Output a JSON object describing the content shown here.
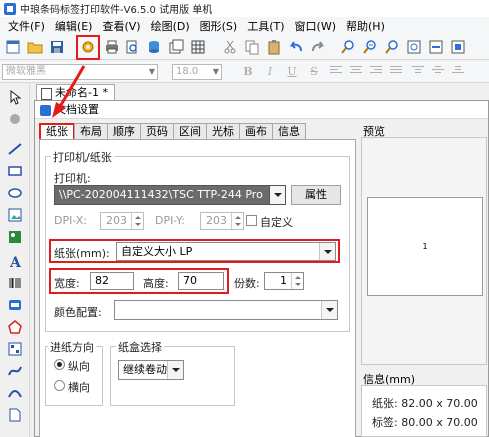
{
  "window": {
    "title": "中琅条码标签打印软件-V6.5.0 试用版 单机"
  },
  "menu": [
    "文件(F)",
    "编辑(E)",
    "查看(V)",
    "绘图(D)",
    "图形(S)",
    "工具(T)",
    "窗口(W)",
    "帮助(H)"
  ],
  "font_toolbar": {
    "font_name": "微软雅黑",
    "font_size": "18.0",
    "bold": "B",
    "italic": "I",
    "underline": "U",
    "strike": "S"
  },
  "document_tab": "未命名-1 *",
  "dialog": {
    "title": "文档设置",
    "tabs": [
      "纸张",
      "布局",
      "顺序",
      "页码",
      "区间",
      "光标",
      "画布",
      "信息"
    ],
    "active_tab": "纸张",
    "printer_group": {
      "label": "打印机/纸张",
      "printer_label": "打印机:",
      "printer_value": "\\\\PC-202004111432\\TSC TTP-244 Pro",
      "properties_button": "属性",
      "dpix_label": "DPI-X:",
      "dpix_value": "203",
      "dpiy_label": "DPI-Y:",
      "dpiy_value": "203",
      "custom_label": "自定义",
      "paper_label": "纸张(mm):",
      "paper_value": "自定义大小 LP",
      "width_label": "宽度:",
      "width_value": "82",
      "height_label": "高度:",
      "height_value": "70",
      "copies_label": "份数:",
      "copies_value": "1",
      "color_label": "颜色配置:",
      "color_value": ""
    },
    "feed_group": {
      "label": "进纸方向",
      "portrait": "纵向",
      "landscape": "横向",
      "selected": "纵向"
    },
    "tray_group": {
      "label": "纸盒选择",
      "value": "继续卷动"
    },
    "preview": {
      "label": "预览",
      "page_number": "1"
    },
    "info": {
      "label": "信息(mm)",
      "paper_line": "纸张: 82.00 x 70.00",
      "label_line": "标签: 80.00 x 70.00"
    }
  },
  "colors": {
    "highlight": "#e31b1b",
    "accent": "#2a6fd6"
  }
}
